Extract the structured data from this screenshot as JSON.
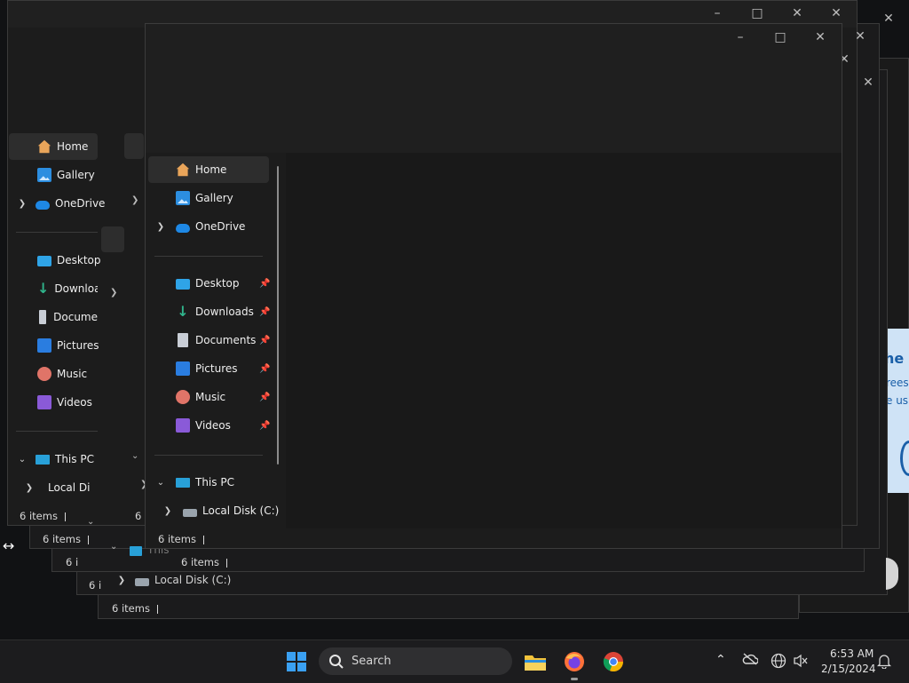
{
  "window": {
    "controls": {
      "minimize": "–",
      "maximize": "□",
      "close": "✕"
    }
  },
  "sidebar": {
    "quick": [
      {
        "label": "Home",
        "icon": "home-icon"
      },
      {
        "label": "Gallery",
        "icon": "gallery-icon"
      },
      {
        "label": "OneDrive",
        "icon": "onedrive-cloud-icon",
        "expandable": true
      }
    ],
    "pinned": [
      {
        "label": "Desktop",
        "icon": "desktop-icon"
      },
      {
        "label": "Downloads",
        "icon": "downloads-icon"
      },
      {
        "label": "Documents",
        "icon": "documents-icon"
      },
      {
        "label": "Pictures",
        "icon": "pictures-icon"
      },
      {
        "label": "Music",
        "icon": "music-icon"
      },
      {
        "label": "Videos",
        "icon": "videos-icon"
      }
    ],
    "this_pc": {
      "label": "This PC",
      "icon": "computer-icon"
    },
    "local_disk": {
      "label": "Local Disk (C:)",
      "icon": "drive-icon"
    }
  },
  "back_window": {
    "sidebar_truncated": [
      "Home",
      "Gallery",
      "OneDrive",
      "Desktop",
      "Downloa",
      "Docume",
      "Pictures",
      "Music",
      "Videos",
      "This PC",
      "Local Di"
    ],
    "this_pc_partial": "This",
    "local_disk": "Local Disk (C:)"
  },
  "status": {
    "items": "6 items"
  },
  "blue_panel": {
    "line1": "he f",
    "line2": "rees",
    "line3": "e us"
  },
  "taskbar": {
    "search_placeholder": "Search",
    "time": "6:53 AM",
    "date": "2/15/2024"
  }
}
